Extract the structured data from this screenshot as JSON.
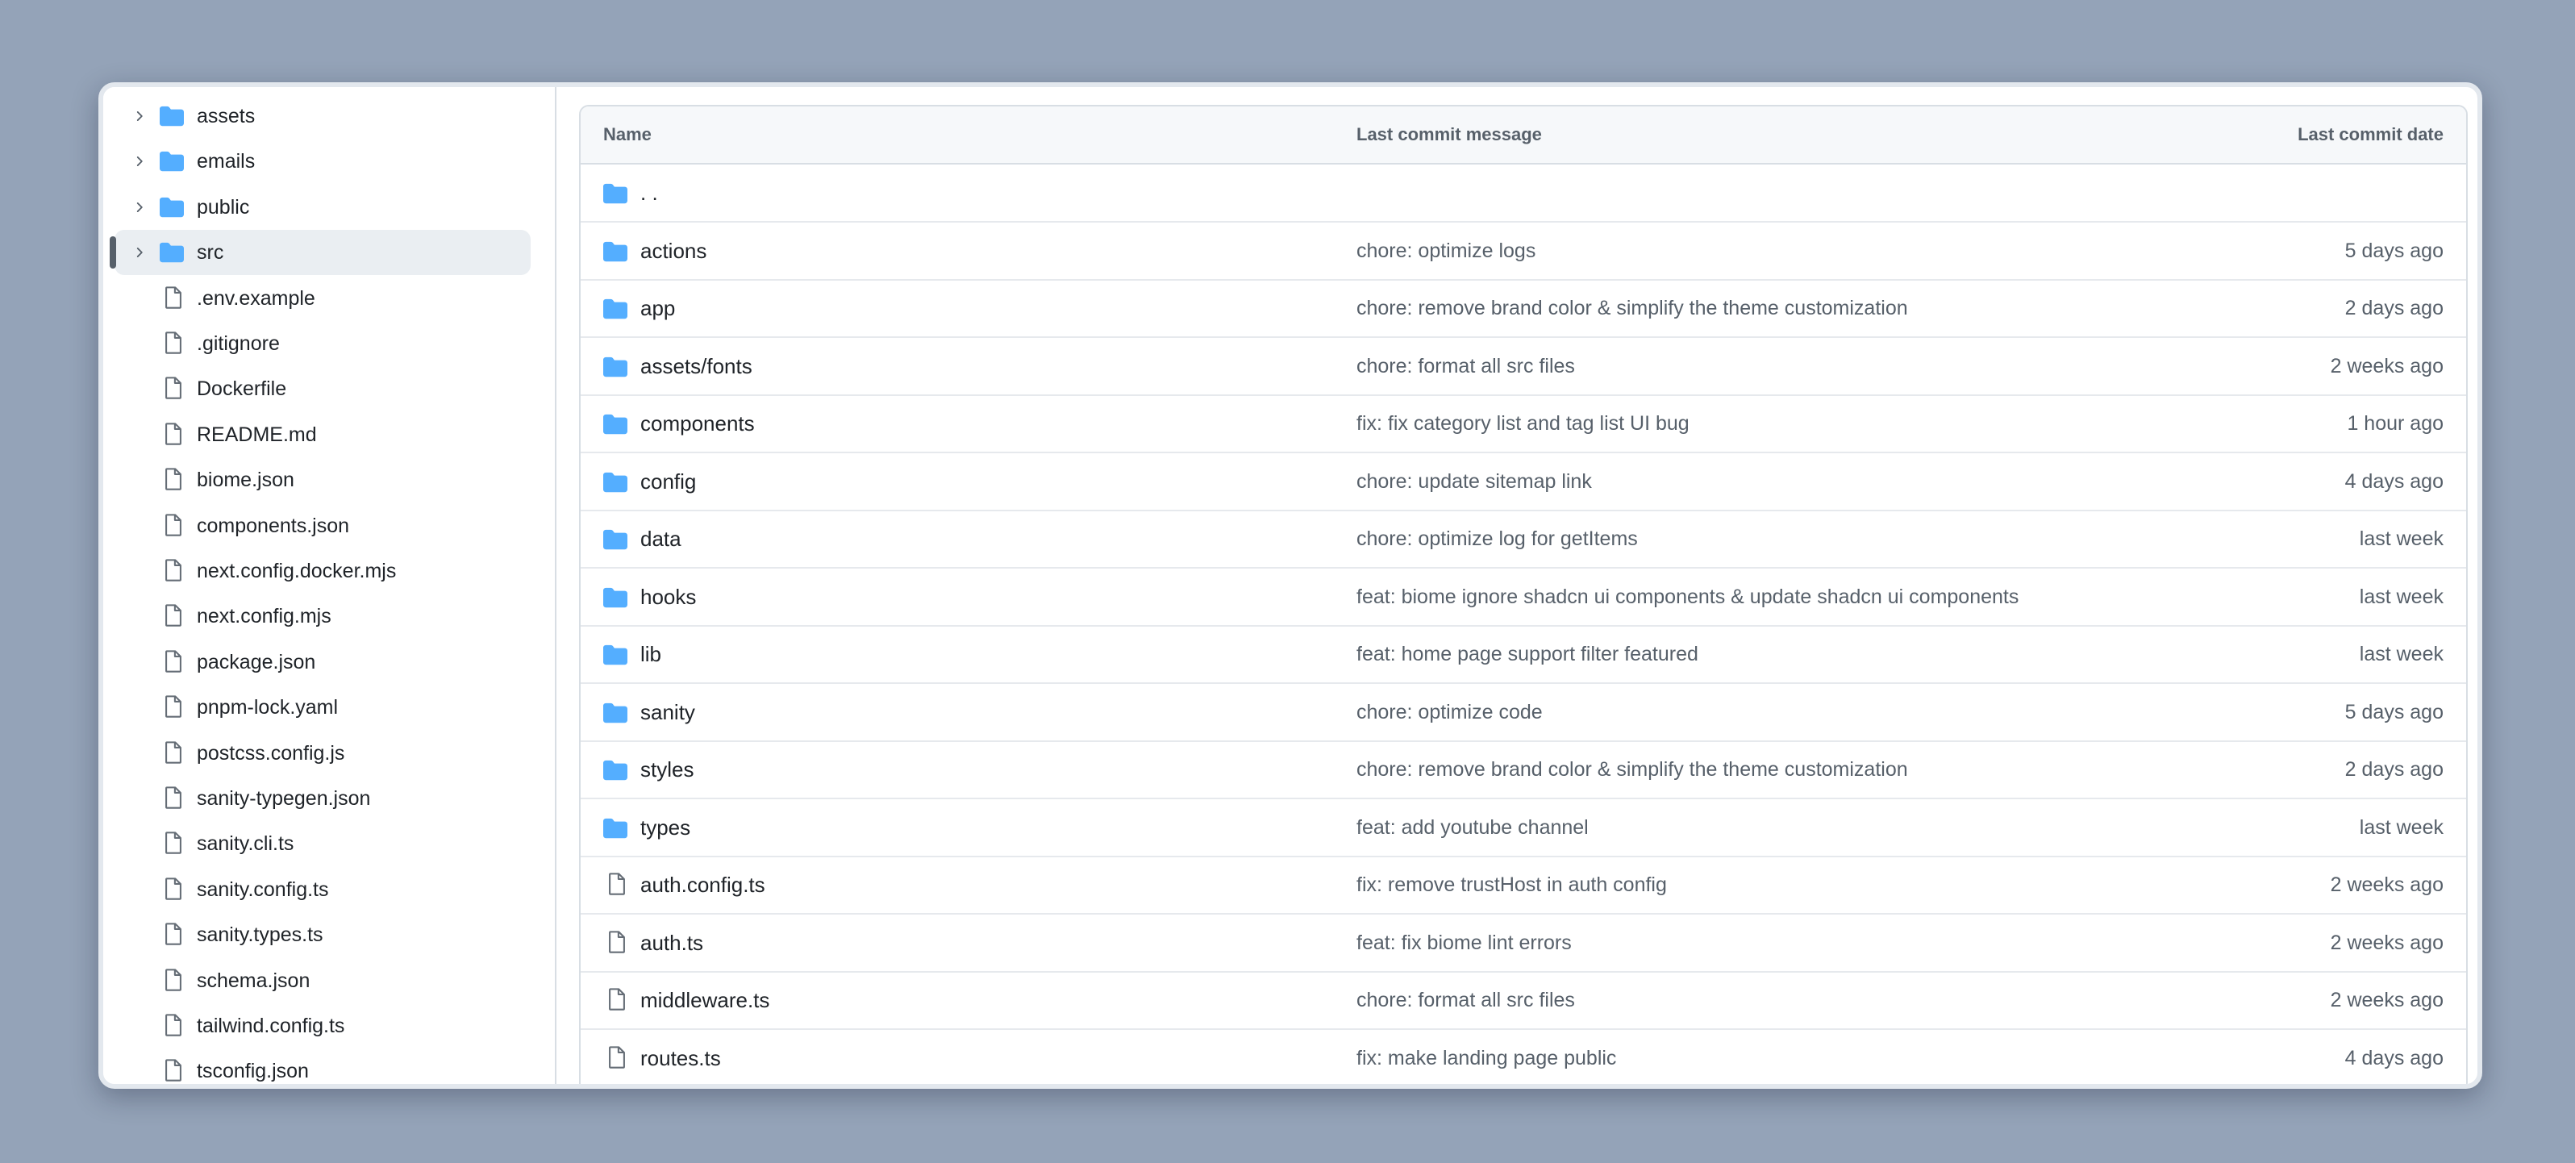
{
  "colors": {
    "background": "#94a3b8",
    "folder": "#54aeff",
    "file_icon": "#656d76",
    "selected_bg": "#eaeef2",
    "text_primary": "#1f2328",
    "text_muted": "#57606a"
  },
  "sidebar": {
    "items": [
      {
        "label": "assets",
        "type": "folder",
        "icon": "folder-icon",
        "selected": false
      },
      {
        "label": "emails",
        "type": "folder",
        "icon": "folder-icon",
        "selected": false
      },
      {
        "label": "public",
        "type": "folder",
        "icon": "folder-icon",
        "selected": false
      },
      {
        "label": "src",
        "type": "folder",
        "icon": "folder-icon",
        "selected": true
      },
      {
        "label": ".env.example",
        "type": "file",
        "icon": "file-icon",
        "selected": false
      },
      {
        "label": ".gitignore",
        "type": "file",
        "icon": "file-icon",
        "selected": false
      },
      {
        "label": "Dockerfile",
        "type": "file",
        "icon": "file-icon",
        "selected": false
      },
      {
        "label": "README.md",
        "type": "file",
        "icon": "file-icon",
        "selected": false
      },
      {
        "label": "biome.json",
        "type": "file",
        "icon": "file-icon",
        "selected": false
      },
      {
        "label": "components.json",
        "type": "file",
        "icon": "file-icon",
        "selected": false
      },
      {
        "label": "next.config.docker.mjs",
        "type": "file",
        "icon": "file-icon",
        "selected": false
      },
      {
        "label": "next.config.mjs",
        "type": "file",
        "icon": "file-icon",
        "selected": false
      },
      {
        "label": "package.json",
        "type": "file",
        "icon": "file-icon",
        "selected": false
      },
      {
        "label": "pnpm-lock.yaml",
        "type": "file",
        "icon": "file-icon",
        "selected": false
      },
      {
        "label": "postcss.config.js",
        "type": "file",
        "icon": "file-icon",
        "selected": false
      },
      {
        "label": "sanity-typegen.json",
        "type": "file",
        "icon": "file-icon",
        "selected": false
      },
      {
        "label": "sanity.cli.ts",
        "type": "file",
        "icon": "file-icon",
        "selected": false
      },
      {
        "label": "sanity.config.ts",
        "type": "file",
        "icon": "file-icon",
        "selected": false
      },
      {
        "label": "sanity.types.ts",
        "type": "file",
        "icon": "file-icon",
        "selected": false
      },
      {
        "label": "schema.json",
        "type": "file",
        "icon": "file-icon",
        "selected": false
      },
      {
        "label": "tailwind.config.ts",
        "type": "file",
        "icon": "file-icon",
        "selected": false
      },
      {
        "label": "tsconfig.json",
        "type": "file",
        "icon": "file-icon",
        "selected": false
      }
    ]
  },
  "table": {
    "headers": {
      "name": "Name",
      "message": "Last commit message",
      "date": "Last commit date"
    },
    "rows": [
      {
        "name": ". .",
        "type": "folder",
        "icon": "folder-icon",
        "message": "",
        "date": ""
      },
      {
        "name": "actions",
        "type": "folder",
        "icon": "folder-icon",
        "message": "chore: optimize logs",
        "date": "5 days ago"
      },
      {
        "name": "app",
        "type": "folder",
        "icon": "folder-icon",
        "message": "chore: remove brand color & simplify the theme customization",
        "date": "2 days ago"
      },
      {
        "name": "assets/fonts",
        "type": "folder",
        "icon": "folder-icon",
        "message": "chore: format all src files",
        "date": "2 weeks ago"
      },
      {
        "name": "components",
        "type": "folder",
        "icon": "folder-icon",
        "message": "fix: fix category list and tag list UI bug",
        "date": "1 hour ago"
      },
      {
        "name": "config",
        "type": "folder",
        "icon": "folder-icon",
        "message": "chore: update sitemap link",
        "date": "4 days ago"
      },
      {
        "name": "data",
        "type": "folder",
        "icon": "folder-icon",
        "message": "chore: optimize log for getItems",
        "date": "last week"
      },
      {
        "name": "hooks",
        "type": "folder",
        "icon": "folder-icon",
        "message": "feat: biome ignore shadcn ui components & update shadcn ui components",
        "date": "last week"
      },
      {
        "name": "lib",
        "type": "folder",
        "icon": "folder-icon",
        "message": "feat: home page support filter featured",
        "date": "last week"
      },
      {
        "name": "sanity",
        "type": "folder",
        "icon": "folder-icon",
        "message": "chore: optimize code",
        "date": "5 days ago"
      },
      {
        "name": "styles",
        "type": "folder",
        "icon": "folder-icon",
        "message": "chore: remove brand color & simplify the theme customization",
        "date": "2 days ago"
      },
      {
        "name": "types",
        "type": "folder",
        "icon": "folder-icon",
        "message": "feat: add youtube channel",
        "date": "last week"
      },
      {
        "name": "auth.config.ts",
        "type": "file",
        "icon": "file-icon",
        "message": "fix: remove trustHost in auth config",
        "date": "2 weeks ago"
      },
      {
        "name": "auth.ts",
        "type": "file",
        "icon": "file-icon",
        "message": "feat: fix biome lint errors",
        "date": "2 weeks ago"
      },
      {
        "name": "middleware.ts",
        "type": "file",
        "icon": "file-icon",
        "message": "chore: format all src files",
        "date": "2 weeks ago"
      },
      {
        "name": "routes.ts",
        "type": "file",
        "icon": "file-icon",
        "message": "fix: make landing page public",
        "date": "4 days ago"
      }
    ]
  }
}
